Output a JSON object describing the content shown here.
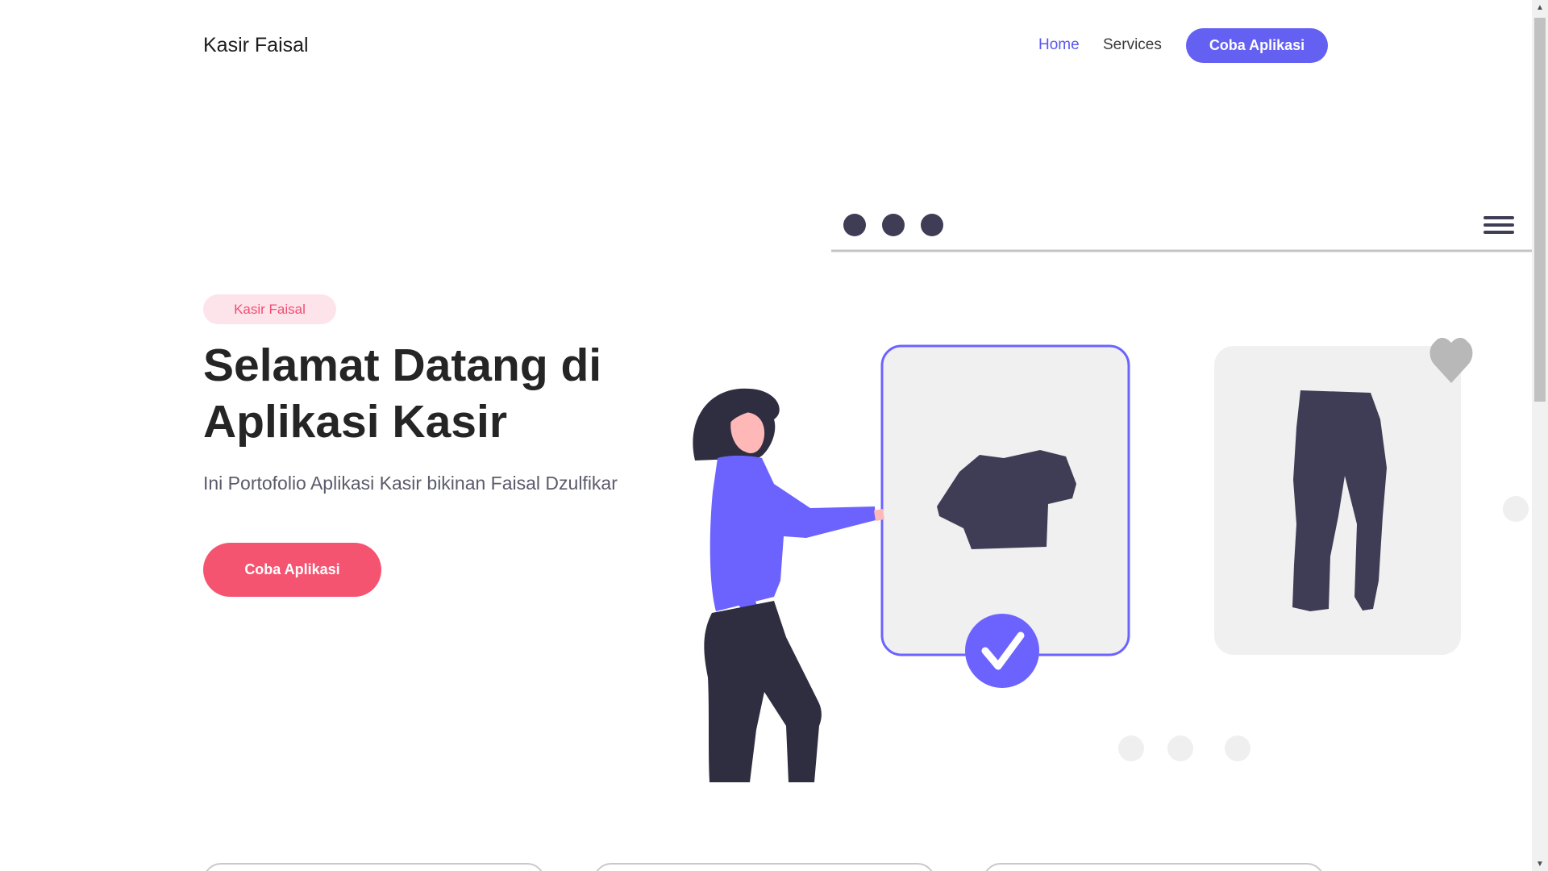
{
  "navbar": {
    "brand": "Kasir Faisal",
    "links": [
      {
        "label": "Home"
      },
      {
        "label": "Services"
      }
    ],
    "cta": "Coba Aplikasi"
  },
  "hero": {
    "badge": "Kasir Faisal",
    "title": "Selamat Datang di Aplikasi Kasir",
    "subtitle": "Ini Portofolio Aplikasi Kasir bikinan Faisal Dzulfikar",
    "cta": "Coba Aplikasi"
  },
  "colors": {
    "accent": "#6360f2",
    "pink": "#f55470",
    "badge_bg": "#fde4ea",
    "dark": "#3f3d56"
  },
  "icons": {
    "menu": "hamburger-icon",
    "favorite": "heart-icon",
    "selected": "check-circle-icon"
  }
}
